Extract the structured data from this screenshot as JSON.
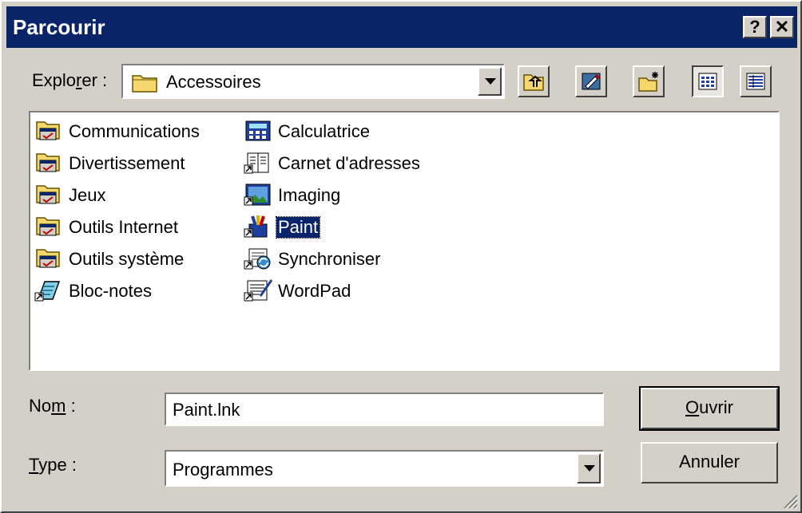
{
  "window": {
    "title": "Parcourir",
    "help_button": "?",
    "close_button": "✕"
  },
  "look_in": {
    "label_pre": "Explo",
    "label_key": "r",
    "label_post": "er :",
    "value": "Accessoires",
    "value_icon": "folder-icon"
  },
  "toolbar": [
    {
      "name": "up-one-level-button",
      "icon": "up-folder-icon"
    },
    {
      "name": "desktop-button",
      "icon": "desktop-icon"
    },
    {
      "name": "new-folder-button",
      "icon": "new-folder-icon"
    },
    {
      "name": "list-view-button",
      "icon": "list-view-icon",
      "pressed": true
    },
    {
      "name": "details-view-button",
      "icon": "details-view-icon",
      "pressed": false
    }
  ],
  "files": {
    "column1": [
      {
        "label": "Communications",
        "icon": "program-group-icon"
      },
      {
        "label": "Divertissement",
        "icon": "program-group-icon"
      },
      {
        "label": "Jeux",
        "icon": "program-group-icon"
      },
      {
        "label": "Outils Internet",
        "icon": "program-group-icon"
      },
      {
        "label": "Outils système",
        "icon": "program-group-icon"
      },
      {
        "label": "Bloc-notes",
        "icon": "notepad-icon"
      }
    ],
    "column2": [
      {
        "label": "Calculatrice",
        "icon": "calculator-icon"
      },
      {
        "label": "Carnet d'adresses",
        "icon": "address-book-icon"
      },
      {
        "label": "Imaging",
        "icon": "imaging-icon"
      },
      {
        "label": "Paint",
        "icon": "paint-icon",
        "selected": true
      },
      {
        "label": "Synchroniser",
        "icon": "sync-icon"
      },
      {
        "label": "WordPad",
        "icon": "wordpad-icon"
      }
    ]
  },
  "filename": {
    "label_pre": "No",
    "label_key": "m",
    "label_post": " :",
    "value": "Paint.lnk"
  },
  "filetype": {
    "label_key": "T",
    "label_post": "ype :",
    "value": "Programmes"
  },
  "buttons": {
    "open_key": "O",
    "open_rest": "uvrir",
    "cancel": "Annuler"
  },
  "colors": {
    "titlebar": "#0a246a",
    "face": "#d4d0c8",
    "selection": "#0a246a"
  }
}
